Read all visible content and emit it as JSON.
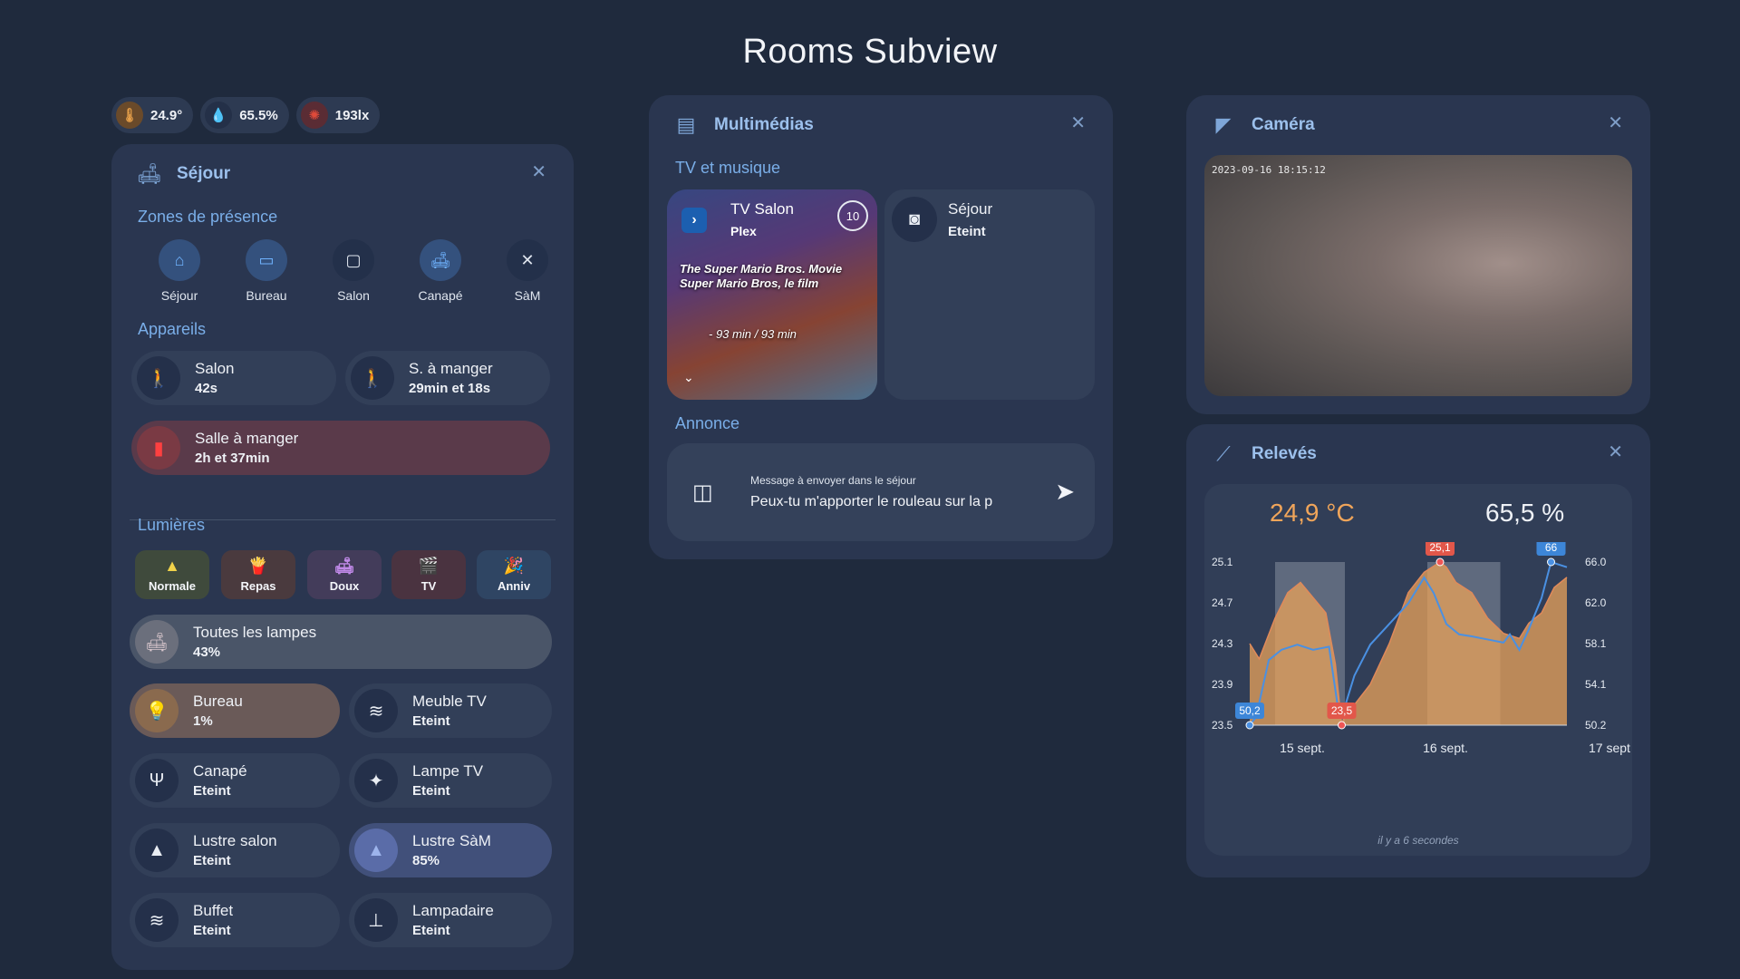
{
  "page": {
    "title": "Rooms Subview"
  },
  "chips": [
    {
      "icon": "thermometer-icon",
      "value": "24.9°",
      "color": "#e7a04a"
    },
    {
      "icon": "humidity-icon",
      "value": "65.5%",
      "color": "#dfe5ee"
    },
    {
      "icon": "illuminance-icon",
      "value": "193lx",
      "color": "#e04a3a"
    }
  ],
  "sejour": {
    "title": "Séjour",
    "zones_label": "Zones de présence",
    "zones": [
      {
        "label": "Séjour",
        "icon": "home-icon",
        "active": true
      },
      {
        "label": "Bureau",
        "icon": "laptop-icon",
        "active": true
      },
      {
        "label": "Salon",
        "icon": "tv-icon",
        "active": false
      },
      {
        "label": "Canapé",
        "icon": "sofa-icon",
        "active": true
      },
      {
        "label": "SàM",
        "icon": "utensils-icon",
        "active": false
      }
    ],
    "devices_label": "Appareils",
    "devices": [
      {
        "name": "Salon",
        "state": "42s"
      },
      {
        "name": "S. à manger",
        "state": "29min et 18s"
      },
      {
        "name": "Salle à manger",
        "state": "2h et 37min"
      }
    ],
    "lights_label": "Lumières",
    "scenes": [
      {
        "label": "Normale",
        "icon": "ceiling-light-icon",
        "bg": "#3f4a3c",
        "fg": "#f1d34a"
      },
      {
        "label": "Repas",
        "icon": "food-icon",
        "bg": "#4a3a3e",
        "fg": "#ee6a3a"
      },
      {
        "label": "Doux",
        "icon": "sofa-icon",
        "bg": "#433c5a",
        "fg": "#c089e8"
      },
      {
        "label": "TV",
        "icon": "clapperboard-icon",
        "bg": "#4a3340",
        "fg": "#e8353a"
      },
      {
        "label": "Anniv",
        "icon": "party-icon",
        "bg": "#2f4563",
        "fg": "#5bb3f0"
      }
    ],
    "lights": [
      {
        "name": "Toutes les lampes",
        "state": "43%"
      },
      {
        "name": "Bureau",
        "state": "1%"
      },
      {
        "name": "Meuble TV",
        "state": "Eteint"
      },
      {
        "name": "Canapé",
        "state": "Eteint"
      },
      {
        "name": "Lampe TV",
        "state": "Eteint"
      },
      {
        "name": "Lustre salon",
        "state": "Eteint"
      },
      {
        "name": "Lustre SàM",
        "state": "85%"
      },
      {
        "name": "Buffet",
        "state": "Eteint"
      },
      {
        "name": "Lampadaire",
        "state": "Eteint"
      }
    ]
  },
  "multimedia": {
    "title": "Multimédias",
    "tv_label": "TV et musique",
    "player": {
      "name": "TV Salon",
      "app": "Plex",
      "badge": "10",
      "title_line1": "The Super Mario Bros. Movie",
      "title_line2": "Super Mario Bros, le film",
      "time": "- 93 min / 93 min"
    },
    "speaker": {
      "name": "Séjour",
      "state": "Eteint"
    },
    "announce_label": "Annonce",
    "announce": {
      "field_label": "Message à envoyer dans le séjour",
      "value": "Peux-tu m'apporter le rouleau sur la p"
    }
  },
  "camera": {
    "title": "Caméra",
    "timestamp": "2023-09-16 18:15:12"
  },
  "releves": {
    "title": "Relevés",
    "temp_value": "24,9 °C",
    "hum_value": "65,5 %",
    "footer": "il y a 6 secondes"
  },
  "chart_data": {
    "type": "area",
    "x_ticks": [
      "15 sept.",
      "16 sept.",
      "17 sept"
    ],
    "left_axis": {
      "ticks": [
        "25.1",
        "24.7",
        "24.3",
        "23.9",
        "23.5"
      ],
      "ylim": [
        23.5,
        25.1
      ]
    },
    "right_axis": {
      "ticks": [
        "66.0",
        "62.0",
        "58.1",
        "54.1",
        "50.2"
      ],
      "ylim": [
        50.2,
        66.0
      ]
    },
    "temp_color": "#e9a35a",
    "hum_color": "#4a90e2",
    "series": [
      {
        "name": "",
        "axis": "left",
        "x": [
          0,
          0.03,
          0.08,
          0.12,
          0.16,
          0.2,
          0.24,
          0.27,
          0.29,
          0.3,
          0.33,
          0.38,
          0.44,
          0.5,
          0.55,
          0.6,
          0.62,
          0.65,
          0.7,
          0.75,
          0.8,
          0.85,
          0.88,
          0.92,
          0.96,
          1.0
        ],
        "y": [
          24.3,
          24.15,
          24.55,
          24.8,
          24.9,
          24.75,
          24.6,
          24.1,
          23.5,
          23.6,
          23.7,
          23.9,
          24.3,
          24.8,
          25.0,
          25.1,
          25.05,
          24.9,
          24.8,
          24.55,
          24.4,
          24.35,
          24.5,
          24.6,
          24.85,
          24.95
        ],
        "min_label": "23,5",
        "max_label": "25,1"
      },
      {
        "name": "",
        "axis": "right",
        "x": [
          0,
          0.02,
          0.06,
          0.1,
          0.15,
          0.2,
          0.25,
          0.28,
          0.3,
          0.33,
          0.38,
          0.44,
          0.5,
          0.55,
          0.58,
          0.62,
          0.66,
          0.7,
          0.75,
          0.8,
          0.82,
          0.85,
          0.88,
          0.92,
          0.95,
          1.0
        ],
        "y": [
          50.2,
          51.0,
          56.5,
          57.5,
          58.0,
          57.5,
          57.8,
          51.5,
          52.0,
          55.0,
          58.0,
          60.0,
          62.0,
          64.5,
          63.0,
          60.0,
          59.0,
          58.8,
          58.5,
          58.2,
          59.0,
          57.5,
          59.5,
          62.5,
          66.0,
          65.5
        ],
        "min_label": "50,2",
        "max_label": "66"
      }
    ],
    "bands": [
      [
        0.08,
        0.3
      ],
      [
        0.56,
        0.79
      ]
    ]
  }
}
